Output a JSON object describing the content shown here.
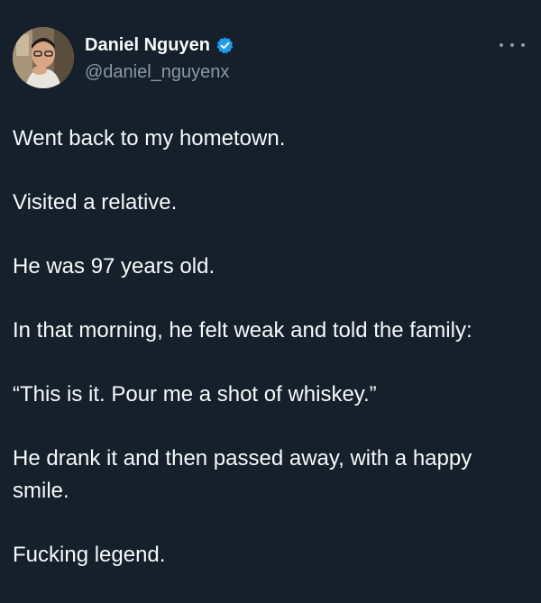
{
  "author": {
    "display_name": "Daniel Nguyen",
    "handle": "@daniel_nguyenx",
    "verified": true,
    "avatar_icon": "profile-photo",
    "verified_icon": "verified-checkmark-icon",
    "verified_color": "#1d9bf0"
  },
  "menu": {
    "icon": "more-options-icon"
  },
  "tweet": {
    "paragraphs": [
      "Went back to my hometown.",
      "Visited a relative.",
      "He was 97 years old.",
      "In that morning, he felt weak and told the family:",
      "“This is it. Pour me a shot of whiskey.”",
      "He drank it and then passed away, with a happy smile.",
      "Fucking legend."
    ]
  },
  "colors": {
    "background": "#15202b",
    "text_primary": "#f7f9f9",
    "text_secondary": "#8b98a5"
  }
}
